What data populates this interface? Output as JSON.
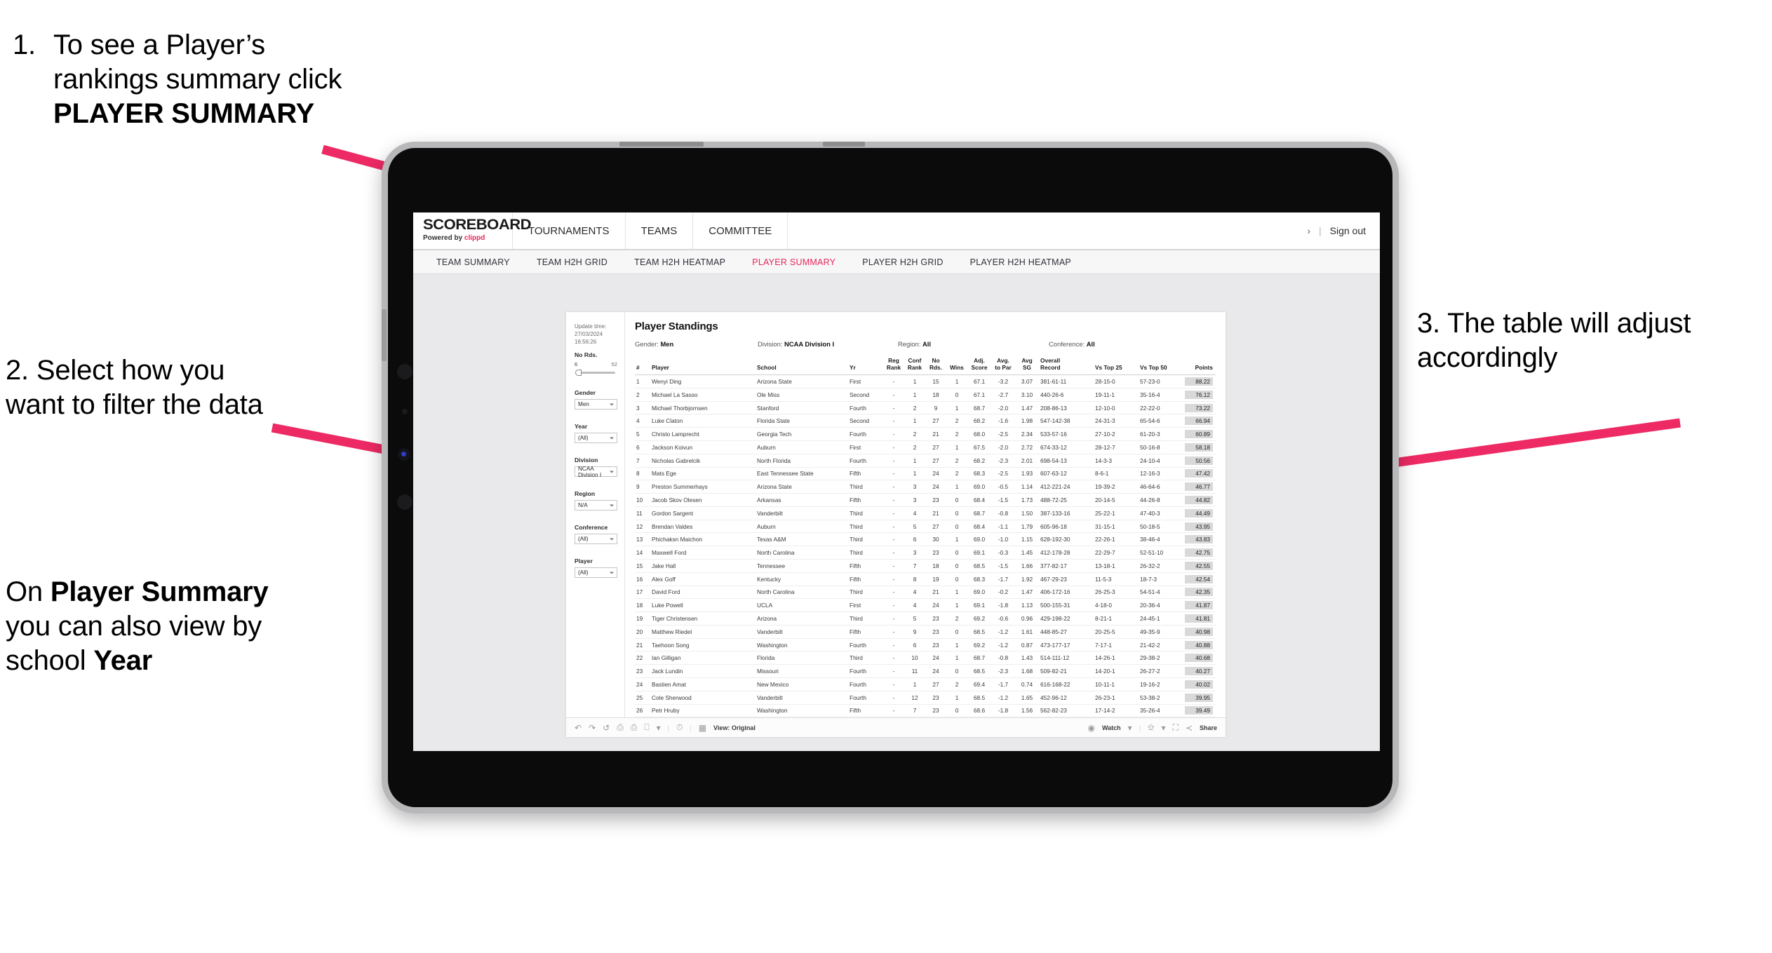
{
  "annotations": {
    "step1_num": "1.",
    "step1_pre": "To see a Player’s rankings summary click ",
    "step1_bold": "PLAYER SUMMARY",
    "step2_pre": "2. Select how you want to filter the data",
    "step2b_a": "On ",
    "step2b_b1": "Player Summary",
    "step2b_c": " you can also view by school ",
    "step2b_b2": "Year",
    "step3": "3. The table will adjust accordingly",
    "arrow_color": "#ED2A63"
  },
  "app": {
    "brand_title": "SCOREBOARD",
    "brand_sub_prefix": "Powered by ",
    "brand_sub_accent": "clippd",
    "top_nav": [
      "TOURNAMENTS",
      "TEAMS",
      "COMMITTEE"
    ],
    "header_right": {
      "chevron": "›",
      "separator": "|",
      "sign_out": "Sign out"
    },
    "tabs": [
      {
        "label": "TEAM SUMMARY",
        "active": false
      },
      {
        "label": "TEAM H2H GRID",
        "active": false
      },
      {
        "label": "TEAM H2H HEATMAP",
        "active": false
      },
      {
        "label": "PLAYER SUMMARY",
        "active": true
      },
      {
        "label": "PLAYER H2H GRID",
        "active": false
      },
      {
        "label": "PLAYER H2H HEATMAP",
        "active": false
      }
    ],
    "accent_color": "#E8265B"
  },
  "sheet": {
    "update_time_label": "Update time:",
    "update_time_value": "27/03/2024 16:56:26",
    "title": "Player Standings",
    "filter_summary": [
      {
        "label": "Gender:",
        "value": "Men"
      },
      {
        "label": "Division:",
        "value": "NCAA Division I"
      },
      {
        "label": "Region:",
        "value": "All"
      },
      {
        "label": "Conference:",
        "value": "All"
      }
    ],
    "filters": {
      "slider": {
        "label": "No Rds.",
        "min": "6",
        "max": "52"
      },
      "dropdowns": [
        {
          "label": "Gender",
          "value": "Men"
        },
        {
          "label": "Year",
          "value": "(All)"
        },
        {
          "label": "Division",
          "value": "NCAA Division I"
        },
        {
          "label": "Region",
          "value": "N/A"
        },
        {
          "label": "Conference",
          "value": "(All)"
        },
        {
          "label": "Player",
          "value": "(All)"
        }
      ]
    },
    "toolbar": {
      "view_label": "View: Original",
      "watch_label": "Watch",
      "share_label": "Share",
      "caret": "▾"
    }
  },
  "chart_data": {
    "type": "table",
    "title": "Player Standings",
    "columns": [
      "#",
      "Player",
      "School",
      "Yr",
      "Reg Rank",
      "Conf Rank",
      "No Rds.",
      "Wins",
      "Adj. Score",
      "Avg. to Par",
      "Avg SG",
      "Overall Record",
      "Vs Top 25",
      "Vs Top 50",
      "Points"
    ],
    "column_headers_wrapped": [
      {
        "l1": "#",
        "l2": ""
      },
      {
        "l1": "",
        "l2": "Player"
      },
      {
        "l1": "",
        "l2": "School"
      },
      {
        "l1": "",
        "l2": "Yr"
      },
      {
        "l1": "Reg",
        "l2": "Rank"
      },
      {
        "l1": "Conf",
        "l2": "Rank"
      },
      {
        "l1": "No",
        "l2": "Rds."
      },
      {
        "l1": "",
        "l2": "Wins"
      },
      {
        "l1": "Adj.",
        "l2": "Score"
      },
      {
        "l1": "Avg.",
        "l2": "to Par"
      },
      {
        "l1": "Avg",
        "l2": "SG"
      },
      {
        "l1": "Overall",
        "l2": "Record"
      },
      {
        "l1": "",
        "l2": "Vs Top 25"
      },
      {
        "l1": "",
        "l2": "Vs Top 50"
      },
      {
        "l1": "",
        "l2": "Points"
      }
    ],
    "rows": [
      [
        "1",
        "Wenyi Ding",
        "Arizona State",
        "First",
        "-",
        "1",
        "15",
        "1",
        "67.1",
        "-3.2",
        "3.07",
        "381-61-11",
        "28-15-0",
        "57-23-0",
        "88.22"
      ],
      [
        "2",
        "Michael La Sasso",
        "Ole Miss",
        "Second",
        "-",
        "1",
        "18",
        "0",
        "67.1",
        "-2.7",
        "3.10",
        "440-26-6",
        "19-11-1",
        "35-16-4",
        "76.12"
      ],
      [
        "3",
        "Michael Thorbjornsen",
        "Stanford",
        "Fourth",
        "-",
        "2",
        "9",
        "1",
        "68.7",
        "-2.0",
        "1.47",
        "208-86-13",
        "12-10-0",
        "22-22-0",
        "73.22"
      ],
      [
        "4",
        "Luke Claton",
        "Florida State",
        "Second",
        "-",
        "1",
        "27",
        "2",
        "68.2",
        "-1.6",
        "1.98",
        "547-142-38",
        "24-31-3",
        "65-54-6",
        "66.94"
      ],
      [
        "5",
        "Christo Lamprecht",
        "Georgia Tech",
        "Fourth",
        "-",
        "2",
        "21",
        "2",
        "68.0",
        "-2.5",
        "2.34",
        "533-57-16",
        "27-10-2",
        "61-20-3",
        "60.89"
      ],
      [
        "6",
        "Jackson Koivun",
        "Auburn",
        "First",
        "-",
        "2",
        "27",
        "1",
        "67.5",
        "-2.0",
        "2.72",
        "674-33-12",
        "28-12-7",
        "50-16-8",
        "58.18"
      ],
      [
        "7",
        "Nicholas Gabrelcik",
        "North Florida",
        "Fourth",
        "-",
        "1",
        "27",
        "2",
        "68.2",
        "-2.3",
        "2.01",
        "698-54-13",
        "14-3-3",
        "24-10-4",
        "50.56"
      ],
      [
        "8",
        "Mats Ege",
        "East Tennessee State",
        "Fifth",
        "-",
        "1",
        "24",
        "2",
        "68.3",
        "-2.5",
        "1.93",
        "607-63-12",
        "8-6-1",
        "12-16-3",
        "47.42"
      ],
      [
        "9",
        "Preston Summerhays",
        "Arizona State",
        "Third",
        "-",
        "3",
        "24",
        "1",
        "69.0",
        "-0.5",
        "1.14",
        "412-221-24",
        "19-39-2",
        "46-64-6",
        "46.77"
      ],
      [
        "10",
        "Jacob Skov Olesen",
        "Arkansas",
        "Fifth",
        "-",
        "3",
        "23",
        "0",
        "68.4",
        "-1.5",
        "1.73",
        "488-72-25",
        "20-14-5",
        "44-26-8",
        "44.82"
      ],
      [
        "11",
        "Gordon Sargent",
        "Vanderbilt",
        "Third",
        "-",
        "4",
        "21",
        "0",
        "68.7",
        "-0.8",
        "1.50",
        "387-133-16",
        "25-22-1",
        "47-40-3",
        "44.49"
      ],
      [
        "12",
        "Brendan Valdes",
        "Auburn",
        "Third",
        "-",
        "5",
        "27",
        "0",
        "68.4",
        "-1.1",
        "1.79",
        "605-96-18",
        "31-15-1",
        "50-18-5",
        "43.95"
      ],
      [
        "13",
        "Phichaksn Maichon",
        "Texas A&M",
        "Third",
        "-",
        "6",
        "30",
        "1",
        "69.0",
        "-1.0",
        "1.15",
        "628-192-30",
        "22-26-1",
        "38-46-4",
        "43.83"
      ],
      [
        "14",
        "Maxwell Ford",
        "North Carolina",
        "Third",
        "-",
        "3",
        "23",
        "0",
        "69.1",
        "-0.3",
        "1.45",
        "412-178-28",
        "22-29-7",
        "52-51-10",
        "42.75"
      ],
      [
        "15",
        "Jake Hall",
        "Tennessee",
        "Fifth",
        "-",
        "7",
        "18",
        "0",
        "68.5",
        "-1.5",
        "1.66",
        "377-82-17",
        "13-18-1",
        "26-32-2",
        "42.55"
      ],
      [
        "16",
        "Alex Goff",
        "Kentucky",
        "Fifth",
        "-",
        "8",
        "19",
        "0",
        "68.3",
        "-1.7",
        "1.92",
        "467-29-23",
        "11-5-3",
        "18-7-3",
        "42.54"
      ],
      [
        "17",
        "David Ford",
        "North Carolina",
        "Third",
        "-",
        "4",
        "21",
        "1",
        "69.0",
        "-0.2",
        "1.47",
        "406-172-16",
        "26-25-3",
        "54-51-4",
        "42.35"
      ],
      [
        "18",
        "Luke Powell",
        "UCLA",
        "First",
        "-",
        "4",
        "24",
        "1",
        "69.1",
        "-1.8",
        "1.13",
        "500-155-31",
        "4-18-0",
        "20-36-4",
        "41.87"
      ],
      [
        "19",
        "Tiger Christensen",
        "Arizona",
        "Third",
        "-",
        "5",
        "23",
        "2",
        "69.2",
        "-0.6",
        "0.96",
        "429-198-22",
        "8-21-1",
        "24-45-1",
        "41.81"
      ],
      [
        "20",
        "Matthew Riedel",
        "Vanderbilt",
        "Fifth",
        "-",
        "9",
        "23",
        "0",
        "68.5",
        "-1.2",
        "1.61",
        "448-85-27",
        "20-25-5",
        "49-35-9",
        "40.98"
      ],
      [
        "21",
        "Taehoon Song",
        "Washington",
        "Fourth",
        "-",
        "6",
        "23",
        "1",
        "69.2",
        "-1.2",
        "0.87",
        "473-177-17",
        "7-17-1",
        "21-42-2",
        "40.88"
      ],
      [
        "22",
        "Ian Gilligan",
        "Florida",
        "Third",
        "-",
        "10",
        "24",
        "1",
        "68.7",
        "-0.8",
        "1.43",
        "514-111-12",
        "14-26-1",
        "29-38-2",
        "40.68"
      ],
      [
        "23",
        "Jack Lundin",
        "Missouri",
        "Fourth",
        "-",
        "11",
        "24",
        "0",
        "68.5",
        "-2.3",
        "1.68",
        "509-82-21",
        "14-20-1",
        "26-27-2",
        "40.27"
      ],
      [
        "24",
        "Bastien Amat",
        "New Mexico",
        "Fourth",
        "-",
        "1",
        "27",
        "2",
        "69.4",
        "-1.7",
        "0.74",
        "616-168-22",
        "10-11-1",
        "19-16-2",
        "40.02"
      ],
      [
        "25",
        "Cole Sherwood",
        "Vanderbilt",
        "Fourth",
        "-",
        "12",
        "23",
        "1",
        "68.5",
        "-1.2",
        "1.65",
        "452-96-12",
        "26-23-1",
        "53-38-2",
        "39.95"
      ],
      [
        "26",
        "Petr Hruby",
        "Washington",
        "Fifth",
        "-",
        "7",
        "23",
        "0",
        "68.6",
        "-1.8",
        "1.56",
        "562-82-23",
        "17-14-2",
        "35-26-4",
        "39.49"
      ]
    ]
  }
}
